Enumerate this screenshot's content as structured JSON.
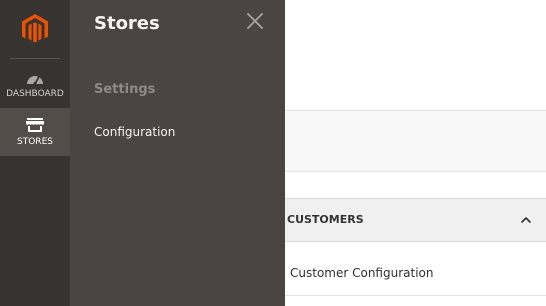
{
  "nav": {
    "items": [
      {
        "label": "DASHBOARD",
        "icon": "dashboard-gauge-icon"
      },
      {
        "label": "STORES",
        "icon": "store-awning-icon"
      }
    ],
    "logo": "magento-logo"
  },
  "flyout": {
    "title": "Stores",
    "close_icon": "close-icon",
    "section_heading": "Settings",
    "link_label": "Configuration"
  },
  "content": {
    "section_title": "CUSTOMERS",
    "section_icon": "chevron-up-icon",
    "item_label": "Customer Configuration"
  },
  "colors": {
    "nav_bg": "#373330",
    "nav_active_bg": "#524d49",
    "flyout_bg": "#4a4542",
    "logo_orange": "#eb5202"
  }
}
